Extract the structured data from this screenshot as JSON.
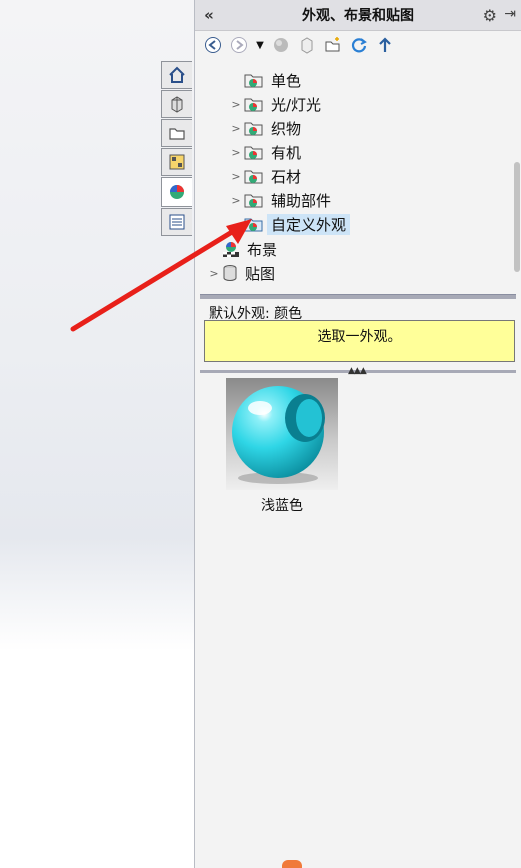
{
  "panel": {
    "title": "外观、布景和贴图",
    "collapse_glyph": "«",
    "options_icon": "gear-icon",
    "pin_icon": "pin-icon"
  },
  "toolbar": {
    "items": [
      "back-icon",
      "forward-icon",
      "dropdown-icon",
      "appearance-icon",
      "part-icon",
      "new-folder-icon",
      "refresh-icon",
      "up-icon"
    ]
  },
  "tree": {
    "items": [
      {
        "label": "单色",
        "has_arrow": false
      },
      {
        "label": "光/灯光",
        "has_arrow": true
      },
      {
        "label": "织物",
        "has_arrow": true
      },
      {
        "label": "有机",
        "has_arrow": true
      },
      {
        "label": "石材",
        "has_arrow": true
      },
      {
        "label": "辅助部件",
        "has_arrow": true
      },
      {
        "label": "自定义外观",
        "has_arrow": false,
        "selected": true
      },
      {
        "label": "布景",
        "has_arrow": false
      },
      {
        "label": "贴图",
        "has_arrow": true
      }
    ]
  },
  "info": {
    "default_label": "默认外观: 颜色",
    "hint": "选取一外观。"
  },
  "thumbnails": [
    {
      "caption": "浅蓝色",
      "color": "#2fd6e6"
    }
  ],
  "side_tabs": [
    "home-icon",
    "part-icon",
    "folder-icon",
    "grid-icon",
    "appearance-icon",
    "list-icon"
  ],
  "colors": {
    "accent": "#cde4f7",
    "hint_bg": "#ffff99",
    "arrow": "#e8201a"
  }
}
